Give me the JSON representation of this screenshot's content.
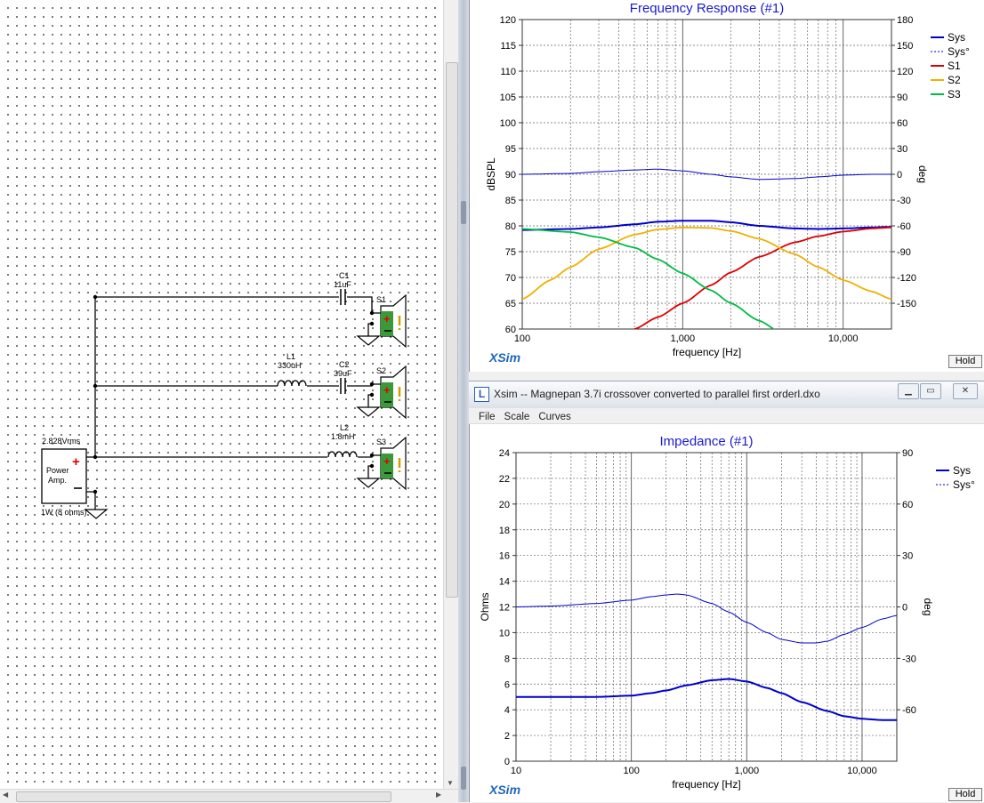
{
  "schematic": {
    "source_voltage": "2.828Vrms",
    "source_name_line1": "Power",
    "source_name_line2": "Amp.",
    "source_load": "1W (8 ohms)",
    "components": {
      "c1_name": "C1",
      "c1_value": "11uF",
      "l1_name": "L1",
      "l1_value": "330uH",
      "c2_name": "C2",
      "c2_value": "39uF",
      "l2_name": "L2",
      "l2_value": "1.8mH",
      "s1_name": "S1",
      "s2_name": "S2",
      "s3_name": "S3"
    },
    "colors": {
      "wire": "#000000",
      "plus": "#e00000",
      "speaker_fill": "#3a9a3a",
      "speaker_mark": "#ffd000"
    }
  },
  "frequency_window": {
    "logo": "XSim",
    "hold_label": "Hold"
  },
  "impedance_window": {
    "title": "Xsim -- Magnepan 3.7i crossover converted to parallel first orderl.dxo",
    "menu": [
      "File",
      "Scale",
      "Curves"
    ],
    "logo": "XSim",
    "hold_label": "Hold",
    "title_buttons": [
      "minimize",
      "restore",
      "close"
    ]
  },
  "chart_data": [
    {
      "type": "line",
      "title": "Frequency Response (#1)",
      "xlabel": "frequency [Hz]",
      "ylabel": "dBSPL",
      "y2label": "deg",
      "xscale": "log",
      "xlim": [
        100,
        20000
      ],
      "ylim": [
        60,
        120
      ],
      "y2lim": [
        -180,
        180
      ],
      "xticks": [
        100,
        1000,
        10000
      ],
      "xtick_labels": [
        "100",
        "1,000",
        "10,000"
      ],
      "yticks": [
        60,
        65,
        70,
        75,
        80,
        85,
        90,
        95,
        100,
        105,
        110,
        115,
        120
      ],
      "y2ticks": [
        -150,
        -120,
        -90,
        -60,
        -30,
        0,
        30,
        60,
        90,
        120,
        150,
        180
      ],
      "grid": true,
      "legend_position": "top-right",
      "colors": {
        "Sys": "#0000cc",
        "S1": "#dd0000",
        "S2": "#f0b000",
        "S3": "#00bb44"
      },
      "series": [
        {
          "name": "Sys",
          "style": "solid",
          "axis": "left",
          "x": [
            100,
            200,
            300,
            500,
            700,
            1000,
            1500,
            2000,
            3000,
            5000,
            7000,
            10000,
            15000,
            20000
          ],
          "y": [
            79.2,
            79.4,
            79.7,
            80.3,
            80.8,
            81.0,
            81.0,
            80.7,
            80.0,
            79.5,
            79.4,
            79.5,
            79.7,
            79.8
          ]
        },
        {
          "name": "Sys°",
          "style": "dashed",
          "axis": "right",
          "x": [
            100,
            200,
            300,
            500,
            700,
            1000,
            1500,
            2000,
            3000,
            5000,
            7000,
            10000,
            15000,
            20000
          ],
          "y": [
            0,
            1,
            3,
            5,
            6,
            4,
            0,
            -3,
            -6,
            -5,
            -3,
            -1,
            0,
            0
          ]
        },
        {
          "name": "S1",
          "style": "solid",
          "axis": "left",
          "x": [
            500,
            700,
            1000,
            1500,
            2000,
            3000,
            5000,
            7000,
            10000,
            15000,
            20000
          ],
          "y": [
            60,
            62.3,
            65,
            68.5,
            71,
            74,
            76.8,
            78,
            78.9,
            79.5,
            79.7
          ]
        },
        {
          "name": "S2",
          "style": "solid",
          "axis": "left",
          "x": [
            100,
            150,
            200,
            300,
            500,
            700,
            1000,
            1500,
            2000,
            3000,
            5000,
            7000,
            10000,
            15000,
            20000
          ],
          "y": [
            65.8,
            69.5,
            72,
            75.5,
            78.3,
            79.3,
            79.7,
            79.6,
            79,
            77.5,
            74.5,
            72,
            69.5,
            67.3,
            65.8
          ]
        },
        {
          "name": "S3",
          "style": "solid",
          "axis": "left",
          "x": [
            100,
            200,
            300,
            500,
            700,
            1000,
            1500,
            2000,
            3000,
            4000
          ],
          "y": [
            79.4,
            78.8,
            77.8,
            75.8,
            73.5,
            70.8,
            67.5,
            65,
            61.6,
            59.5
          ]
        }
      ]
    },
    {
      "type": "line",
      "title": "Impedance (#1)",
      "xlabel": "frequency [Hz]",
      "ylabel": "Ohms",
      "y2label": "deg",
      "xscale": "log",
      "xlim": [
        10,
        20000
      ],
      "ylim": [
        0,
        24
      ],
      "y2lim": [
        -90,
        90
      ],
      "xticks": [
        10,
        100,
        1000,
        10000
      ],
      "xtick_labels": [
        "10",
        "100",
        "1,000",
        "10,000"
      ],
      "yticks": [
        0,
        2,
        4,
        6,
        8,
        10,
        12,
        14,
        16,
        18,
        20,
        22,
        24
      ],
      "y2ticks": [
        -60,
        -30,
        0,
        30,
        60,
        90
      ],
      "grid": true,
      "legend_position": "top-right",
      "colors": {
        "Sys": "#0000cc"
      },
      "series": [
        {
          "name": "Sys",
          "style": "solid",
          "axis": "left",
          "x": [
            10,
            20,
            50,
            100,
            150,
            200,
            300,
            500,
            700,
            1000,
            1500,
            2000,
            3000,
            5000,
            7000,
            10000,
            15000,
            20000
          ],
          "y": [
            5.0,
            5.0,
            5.0,
            5.1,
            5.3,
            5.5,
            5.9,
            6.3,
            6.4,
            6.2,
            5.7,
            5.3,
            4.6,
            3.9,
            3.5,
            3.3,
            3.2,
            3.2
          ]
        },
        {
          "name": "Sys°",
          "style": "dashed",
          "axis": "right",
          "x": [
            10,
            20,
            50,
            100,
            150,
            200,
            250,
            300,
            500,
            700,
            1000,
            1500,
            2000,
            3000,
            4000,
            5000,
            7000,
            10000,
            15000,
            20000
          ],
          "y": [
            0,
            0.5,
            2,
            4,
            6,
            7,
            7.5,
            7,
            2,
            -3,
            -9,
            -15,
            -19,
            -21,
            -21,
            -20,
            -16,
            -12,
            -7,
            -5
          ]
        }
      ]
    }
  ]
}
